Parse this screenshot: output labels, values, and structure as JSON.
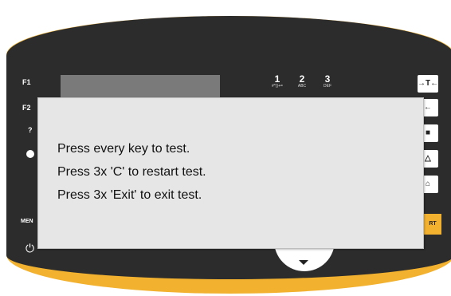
{
  "device": {
    "colors": {
      "panel": "#2c2c2c",
      "bezel": "#f2b230",
      "lcd": "#7a7a7a",
      "dialog": "#e6e6e6"
    },
    "function_keys": [
      "F1",
      "F2",
      "?",
      "MEN"
    ],
    "digits": [
      {
        "num": "1",
        "sub": "#*()+="
      },
      {
        "num": "2",
        "sub": "ABC"
      },
      {
        "num": "3",
        "sub": "DEF"
      }
    ],
    "side_buttons": [
      "→T←",
      "←",
      "■",
      "△",
      "⌂"
    ],
    "start_label": "RT",
    "power_icon": "⏻"
  },
  "dialog": {
    "lines": [
      "Press every key to test.",
      "Press 3x 'C' to restart test.",
      "Press 3x 'Exit' to exit test."
    ]
  }
}
